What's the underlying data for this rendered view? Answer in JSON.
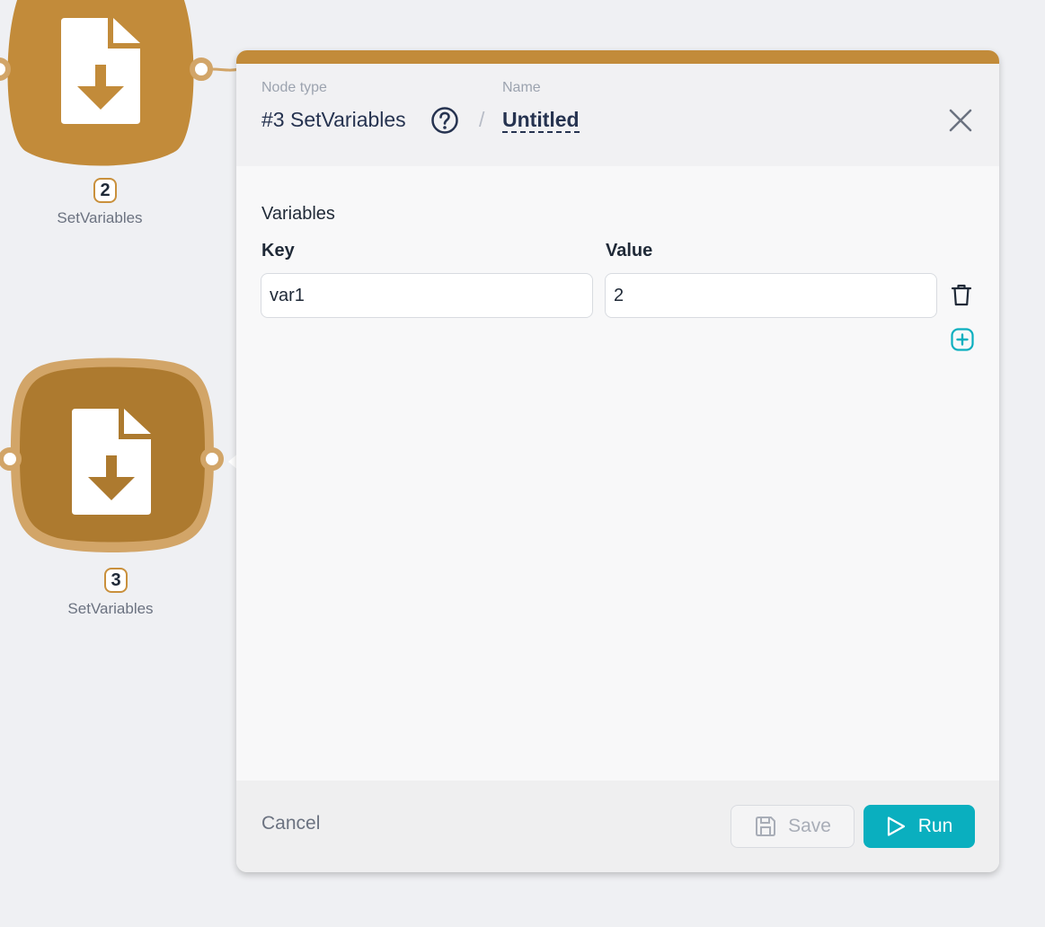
{
  "nodes": [
    {
      "number": "2",
      "label": "SetVariables",
      "icon": "file-download-icon"
    },
    {
      "number": "3",
      "label": "SetVariables",
      "icon": "file-download-icon"
    }
  ],
  "panel": {
    "node_type_caption": "Node type",
    "node_type_value": "#3 SetVariables",
    "name_caption": "Name",
    "name_value": "Untitled",
    "separator": "/",
    "section_title": "Variables",
    "columns": {
      "key": "Key",
      "value": "Value"
    },
    "rows": [
      {
        "key": "var1",
        "value": "2"
      }
    ],
    "footer": {
      "cancel": "Cancel",
      "save": "Save",
      "run": "Run"
    }
  },
  "colors": {
    "node_fill": "#c28b3a",
    "node_fill_selected": "#ad7a2f",
    "accent": "#0aafbf",
    "header_text": "#263350"
  }
}
